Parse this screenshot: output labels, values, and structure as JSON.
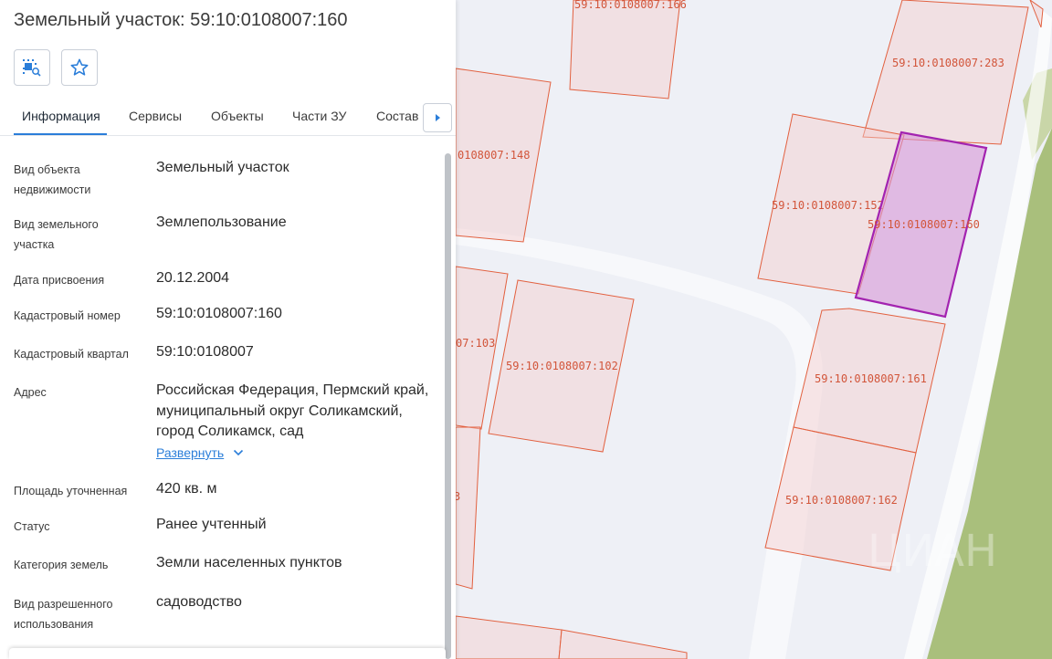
{
  "title": "Земельный участок: 59:10:0108007:160",
  "toolbar": {
    "zoom_icon": "locate-on-map-icon",
    "favorite_icon": "star-icon"
  },
  "tabs": [
    {
      "label": "Информация",
      "active": true
    },
    {
      "label": "Сервисы",
      "active": false
    },
    {
      "label": "Объекты",
      "active": false
    },
    {
      "label": "Части ЗУ",
      "active": false
    },
    {
      "label": "Состав",
      "active": false
    }
  ],
  "fields": [
    {
      "label": "Вид объекта недвижимости",
      "value": "Земельный участок"
    },
    {
      "label": "Вид земельного участка",
      "value": "Землепользование"
    },
    {
      "label": "Дата присвоения",
      "value": "20.12.2004"
    },
    {
      "label": "Кадастровый номер",
      "value": "59:10:0108007:160"
    },
    {
      "label": "Кадастровый квартал",
      "value": "59:10:0108007"
    },
    {
      "label": "Адрес",
      "value": "Российская Федерация, Пермский край, муниципальный округ Соликамский, город Соликамск, сад"
    },
    {
      "label": "Площадь уточненная",
      "value": "420 кв. м"
    },
    {
      "label": "Статус",
      "value": "Ранее учтенный"
    },
    {
      "label": "Категория земель",
      "value": "Земли населенных пунктов"
    },
    {
      "label": "Вид разрешенного использования",
      "value": "садоводство"
    }
  ],
  "expand_link": "Развернуть",
  "colors": {
    "accent": "#2b7ed9",
    "parcel_stroke": "#e2603f",
    "parcel_selected_stroke": "#a323b0",
    "green_area": "#a9bf7c",
    "road": "#eef0f6"
  },
  "map": {
    "parcels": [
      {
        "id": "59:10:0108007:166"
      },
      {
        "id": "59:10:0108007:283"
      },
      {
        "id": "0108007:148"
      },
      {
        "id": "59:10:0108007:152"
      },
      {
        "id": "59:10:0108007:160",
        "selected": true
      },
      {
        "id": "07:103"
      },
      {
        "id": "59:10:0108007:102"
      },
      {
        "id": "59:10:0108007:161"
      },
      {
        "id": "59:10:0108007:162"
      },
      {
        "id": "3"
      }
    ]
  }
}
